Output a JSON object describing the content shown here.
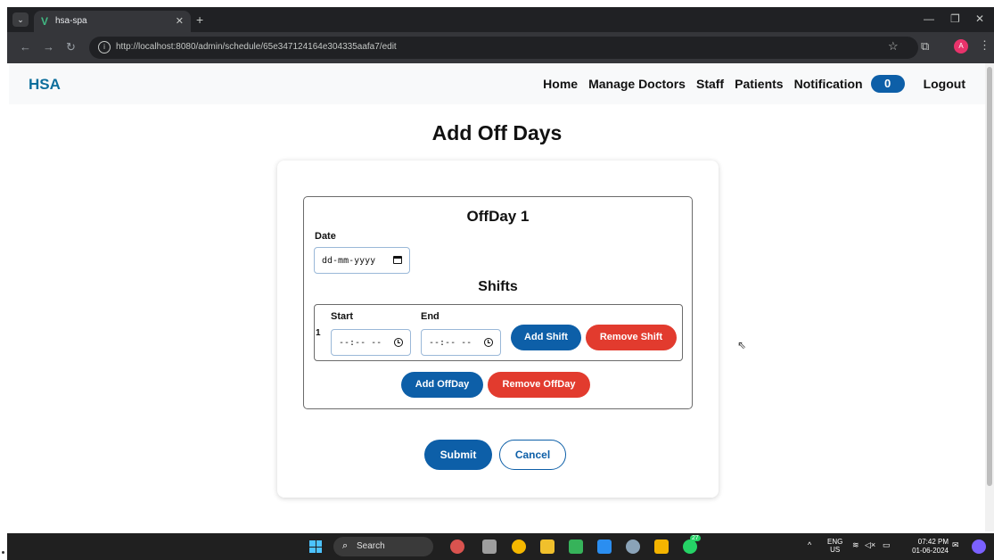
{
  "browser": {
    "tab_title": "hsa-spa",
    "url": "http://localhost:8080/admin/schedule/65e347124164e304335aafa7/edit",
    "profile_initial": "A"
  },
  "navbar": {
    "brand": "HSA",
    "links": [
      "Home",
      "Manage Doctors",
      "Staff",
      "Patients",
      "Notification"
    ],
    "notification_count": "0",
    "logout": "Logout"
  },
  "page": {
    "title": "Add Off Days"
  },
  "offday": {
    "title": "OffDay 1",
    "date_label": "Date",
    "date_placeholder": "dd-mm-yyyy",
    "shifts_title": "Shifts",
    "shift": {
      "index": "1",
      "start_label": "Start",
      "end_label": "End",
      "start_placeholder": "--:-- --",
      "end_placeholder": "--:-- --",
      "add_shift": "Add Shift",
      "remove_shift": "Remove Shift"
    },
    "add_offday": "Add OffDay",
    "remove_offday": "Remove OffDay"
  },
  "form": {
    "submit": "Submit",
    "cancel": "Cancel"
  },
  "taskbar": {
    "search": "Search",
    "lang_line1": "ENG",
    "lang_line2": "US",
    "time": "07:42 PM",
    "date": "01-06-2024",
    "badge_count": "27"
  },
  "colors": {
    "primary": "#0d5fa8",
    "danger": "#e23b2e",
    "brand": "#0d6e9c"
  }
}
